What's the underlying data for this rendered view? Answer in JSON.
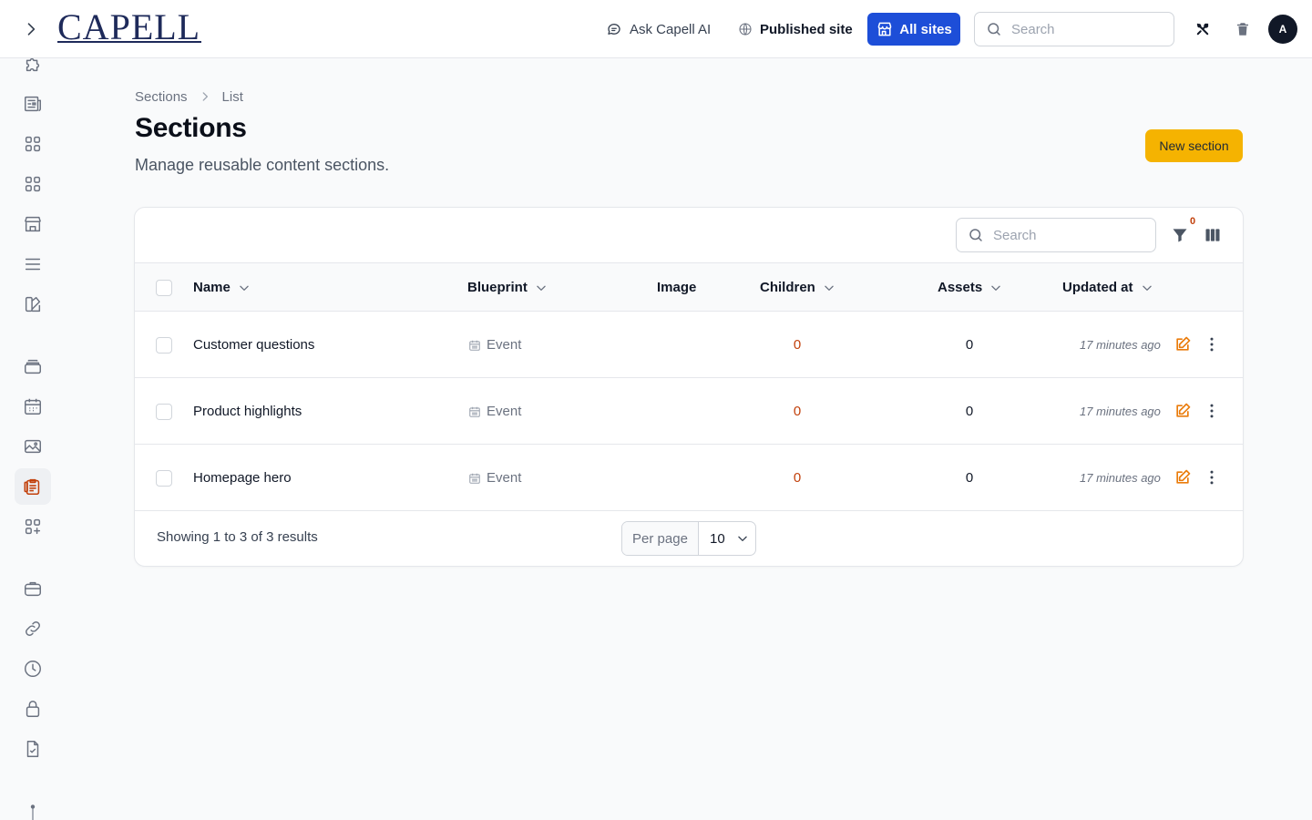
{
  "header": {
    "logo_text": "CAPELL",
    "ask_ai_label": "Ask Capell AI",
    "published_site_label": "Published site",
    "all_sites_label": "All sites",
    "search_placeholder": "Search",
    "avatar_initial": "A"
  },
  "sidebar": {
    "items": [
      {
        "icon": "puzzle-icon"
      },
      {
        "icon": "newspaper-icon"
      },
      {
        "icon": "grid-icon"
      },
      {
        "icon": "grid-icon"
      },
      {
        "icon": "storefront-icon"
      },
      {
        "icon": "menu-lines-icon"
      },
      {
        "icon": "swatch-icon"
      },
      {
        "icon": "stack-icon"
      },
      {
        "icon": "calendar-icon"
      },
      {
        "icon": "image-icon"
      },
      {
        "icon": "clipboard-icon",
        "active": true
      },
      {
        "icon": "squares-plus-icon"
      },
      {
        "icon": "briefcase-icon"
      },
      {
        "icon": "link-icon"
      },
      {
        "icon": "clock-icon"
      },
      {
        "icon": "lock-icon"
      },
      {
        "icon": "document-check-icon"
      }
    ]
  },
  "breadcrumb": {
    "parent": "Sections",
    "current": "List"
  },
  "page": {
    "title": "Sections",
    "subtitle": "Manage reusable content sections.",
    "new_button": "New section"
  },
  "table": {
    "search_placeholder": "Search",
    "filter_count": "0",
    "columns": {
      "name": "Name",
      "blueprint": "Blueprint",
      "image": "Image",
      "children": "Children",
      "assets": "Assets",
      "updated_at": "Updated at"
    },
    "rows": [
      {
        "name": "Customer questions",
        "blueprint": "Event",
        "children": "0",
        "assets": "0",
        "updated_at": "17 minutes ago"
      },
      {
        "name": "Product highlights",
        "blueprint": "Event",
        "children": "0",
        "assets": "0",
        "updated_at": "17 minutes ago"
      },
      {
        "name": "Homepage hero",
        "blueprint": "Event",
        "children": "0",
        "assets": "0",
        "updated_at": "17 minutes ago"
      }
    ],
    "footer": {
      "showing": "Showing 1 to 3 of 3 results",
      "per_page_label": "Per page",
      "per_page_value": "10"
    }
  },
  "colors": {
    "accent_blue": "#1d4ed8",
    "accent_yellow": "#f5b301",
    "accent_orange": "#c2410c",
    "logo_navy": "#1e2a5a"
  }
}
